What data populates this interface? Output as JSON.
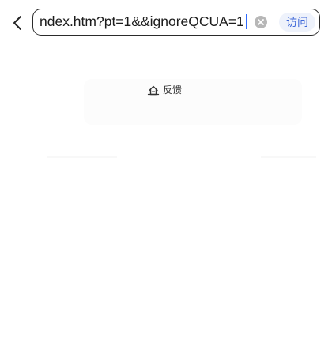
{
  "address_bar": {
    "url_text": "ndex.htm?pt=1&&ignoreQCUA=1",
    "visit_label": "访问"
  },
  "feedback": {
    "label": "反馈"
  },
  "icons": {
    "back": "chevron-left-icon",
    "clear": "clear-circle-icon",
    "feedback": "feedback-icon"
  },
  "colors": {
    "accent": "#3d67d8",
    "caret": "#2f6bff",
    "visit_bg": "#eef2fb"
  }
}
